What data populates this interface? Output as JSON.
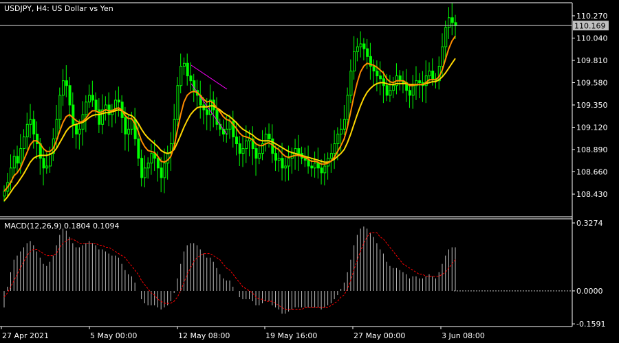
{
  "window": {
    "header": "USDJPY, H4:  US Dollar vs Yen",
    "current_price": "110.169",
    "macd_label": "MACD(12,26,9) 0.1804 0.1094"
  },
  "colors": {
    "background": "#000000",
    "bull_candle": "#00ff00",
    "bear_candle": "#00ff00",
    "ma_fast": "#ff8c00",
    "ma_slow": "#ffd700",
    "macd_hist": "#c0c0c0",
    "macd_signal": "#ff0000",
    "grid_line": "#c0c0c0",
    "price_tag_bg": "#c0c0c0",
    "trend_channel": "#ff00ff"
  },
  "price_axis": {
    "ticks": [
      "110.270",
      "110.040",
      "109.810",
      "109.580",
      "109.350",
      "109.120",
      "108.890",
      "108.660",
      "108.430"
    ]
  },
  "macd_axis": {
    "ticks": [
      "0.3274",
      "0.0000",
      "-0.1591"
    ]
  },
  "time_axis": {
    "ticks": [
      "27 Apr 2021",
      "5 May 00:00",
      "12 May 08:00",
      "19 May 16:00",
      "27 May 00:00",
      "3 Jun 08:00"
    ]
  },
  "chart_data": {
    "type": "line",
    "symbol": "USDJPY",
    "timeframe": "H4",
    "price_ylim": [
      108.33,
      110.33
    ],
    "macd_ylim": [
      -0.1591,
      0.3274
    ],
    "x_ticks": [
      "27 Apr 2021",
      "5 May 00:00",
      "12 May 08:00",
      "19 May 16:00",
      "27 May 00:00",
      "3 Jun 08:00"
    ],
    "price_close": [
      108.46,
      108.55,
      108.7,
      108.82,
      108.75,
      108.9,
      109.02,
      109.15,
      109.2,
      109.05,
      108.95,
      108.8,
      108.7,
      108.72,
      108.85,
      109.0,
      109.2,
      109.45,
      109.6,
      109.55,
      109.35,
      109.15,
      109.05,
      109.1,
      109.25,
      109.38,
      109.45,
      109.4,
      109.3,
      109.15,
      109.3,
      109.35,
      109.25,
      109.3,
      109.4,
      109.38,
      109.22,
      109.05,
      109.1,
      109.2,
      109.0,
      108.8,
      108.6,
      108.7,
      108.75,
      108.85,
      108.8,
      108.7,
      108.6,
      108.75,
      108.85,
      108.95,
      109.2,
      109.55,
      109.75,
      109.78,
      109.65,
      109.6,
      109.5,
      109.45,
      109.35,
      109.3,
      109.25,
      109.4,
      109.3,
      109.15,
      109.1,
      109.05,
      109.1,
      109.18,
      109.02,
      108.95,
      108.85,
      108.9,
      108.98,
      109.0,
      108.9,
      108.8,
      108.85,
      108.95,
      109.05,
      109.0,
      108.85,
      108.78,
      108.8,
      108.7,
      108.72,
      108.8,
      108.85,
      108.9,
      108.85,
      108.8,
      108.78,
      108.72,
      108.7,
      108.75,
      108.7,
      108.65,
      108.72,
      108.8,
      108.85,
      108.95,
      109.05,
      109.1,
      109.2,
      109.45,
      109.7,
      109.9,
      109.95,
      109.98,
      109.93,
      109.85,
      109.75,
      109.7,
      109.65,
      109.62,
      109.55,
      109.45,
      109.5,
      109.55,
      109.65,
      109.6,
      109.58,
      109.5,
      109.45,
      109.55,
      109.6,
      109.58,
      109.55,
      109.65,
      109.7,
      109.62,
      109.6,
      109.75,
      109.95,
      110.15,
      110.25,
      110.2,
      110.17
    ],
    "ma_fast": [
      108.46,
      108.5,
      108.55,
      108.62,
      108.65,
      108.7,
      108.78,
      108.86,
      108.94,
      108.98,
      108.98,
      108.95,
      108.9,
      108.87,
      108.87,
      108.9,
      108.98,
      109.08,
      109.17,
      109.23,
      109.25,
      109.22,
      109.19,
      109.17,
      109.18,
      109.21,
      109.26,
      109.29,
      109.29,
      109.27,
      109.28,
      109.3,
      109.29,
      109.29,
      109.31,
      109.32,
      109.3,
      109.24,
      109.21,
      109.21,
      109.16,
      109.08,
      108.98,
      108.92,
      108.88,
      108.87,
      108.86,
      108.82,
      108.77,
      108.76,
      108.78,
      108.82,
      108.92,
      109.09,
      109.25,
      109.38,
      109.45,
      109.48,
      109.49,
      109.48,
      109.45,
      109.41,
      109.38,
      109.39,
      109.37,
      109.32,
      109.28,
      109.23,
      109.2,
      109.19,
      109.15,
      109.11,
      109.06,
      109.03,
      109.02,
      109.01,
      108.99,
      108.95,
      108.93,
      108.93,
      108.95,
      108.96,
      108.94,
      108.91,
      108.89,
      108.85,
      108.82,
      108.81,
      108.82,
      108.83,
      108.83,
      108.82,
      108.81,
      108.79,
      108.77,
      108.77,
      108.76,
      108.74,
      108.74,
      108.75,
      108.77,
      108.81,
      108.87,
      108.93,
      109.0,
      109.12,
      109.28,
      109.44,
      109.58,
      109.69,
      109.75,
      109.78,
      109.77,
      109.76,
      109.74,
      109.71,
      109.68,
      109.62,
      109.59,
      109.58,
      109.6,
      109.6,
      109.6,
      109.58,
      109.55,
      109.55,
      109.56,
      109.56,
      109.56,
      109.58,
      109.61,
      109.61,
      109.61,
      109.64,
      109.71,
      109.82,
      109.93,
      110.01,
      110.06
    ],
    "ma_slow": [
      108.36,
      108.4,
      108.45,
      108.5,
      108.54,
      108.59,
      108.64,
      108.7,
      108.76,
      108.8,
      108.82,
      108.83,
      108.83,
      108.83,
      108.84,
      108.86,
      108.9,
      108.96,
      109.02,
      109.08,
      109.12,
      109.14,
      109.15,
      109.16,
      109.17,
      109.19,
      109.22,
      109.24,
      109.25,
      109.25,
      109.26,
      109.27,
      109.27,
      109.28,
      109.29,
      109.3,
      109.29,
      109.27,
      109.25,
      109.24,
      109.21,
      109.16,
      109.1,
      109.05,
      109.01,
      108.98,
      108.95,
      108.92,
      108.88,
      108.86,
      108.85,
      108.86,
      108.89,
      108.96,
      109.04,
      109.12,
      109.19,
      109.25,
      109.29,
      109.32,
      109.33,
      109.33,
      109.33,
      109.34,
      109.34,
      109.32,
      109.3,
      109.27,
      109.25,
      109.23,
      109.2,
      109.17,
      109.13,
      109.1,
      109.08,
      109.06,
      109.04,
      109.01,
      108.99,
      108.98,
      108.98,
      108.98,
      108.97,
      108.95,
      108.93,
      108.91,
      108.89,
      108.87,
      108.86,
      108.85,
      108.84,
      108.83,
      108.82,
      108.81,
      108.8,
      108.79,
      108.78,
      108.77,
      108.76,
      108.76,
      108.77,
      108.79,
      108.82,
      108.85,
      108.89,
      108.96,
      109.05,
      109.15,
      109.25,
      109.34,
      109.42,
      109.48,
      109.52,
      109.55,
      109.57,
      109.58,
      109.58,
      109.57,
      109.56,
      109.56,
      109.57,
      109.57,
      109.57,
      109.57,
      109.56,
      109.56,
      109.56,
      109.56,
      109.56,
      109.57,
      109.58,
      109.59,
      109.59,
      109.61,
      109.64,
      109.68,
      109.73,
      109.78,
      109.83
    ],
    "macd_hist": [
      -0.08,
      0.02,
      0.09,
      0.15,
      0.17,
      0.19,
      0.21,
      0.23,
      0.24,
      0.22,
      0.19,
      0.16,
      0.13,
      0.12,
      0.14,
      0.17,
      0.22,
      0.27,
      0.3,
      0.29,
      0.26,
      0.23,
      0.21,
      0.21,
      0.22,
      0.23,
      0.24,
      0.23,
      0.22,
      0.2,
      0.2,
      0.19,
      0.18,
      0.17,
      0.17,
      0.16,
      0.13,
      0.1,
      0.08,
      0.07,
      0.04,
      0.0,
      -0.04,
      -0.06,
      -0.07,
      -0.07,
      -0.07,
      -0.08,
      -0.09,
      -0.08,
      -0.07,
      -0.05,
      -0.01,
      0.06,
      0.13,
      0.19,
      0.22,
      0.23,
      0.23,
      0.22,
      0.2,
      0.18,
      0.16,
      0.16,
      0.14,
      0.11,
      0.08,
      0.06,
      0.05,
      0.05,
      0.02,
      0.0,
      -0.03,
      -0.04,
      -0.04,
      -0.04,
      -0.05,
      -0.07,
      -0.07,
      -0.06,
      -0.05,
      -0.05,
      -0.07,
      -0.08,
      -0.09,
      -0.11,
      -0.11,
      -0.1,
      -0.09,
      -0.08,
      -0.08,
      -0.08,
      -0.08,
      -0.08,
      -0.08,
      -0.08,
      -0.08,
      -0.09,
      -0.08,
      -0.07,
      -0.06,
      -0.04,
      -0.02,
      0.01,
      0.04,
      0.09,
      0.15,
      0.22,
      0.27,
      0.3,
      0.31,
      0.3,
      0.28,
      0.26,
      0.23,
      0.2,
      0.18,
      0.14,
      0.12,
      0.11,
      0.11,
      0.1,
      0.09,
      0.08,
      0.06,
      0.07,
      0.07,
      0.06,
      0.06,
      0.07,
      0.08,
      0.07,
      0.06,
      0.09,
      0.13,
      0.17,
      0.2,
      0.21,
      0.21
    ],
    "macd_signal": [
      -0.03,
      -0.01,
      0.02,
      0.05,
      0.08,
      0.11,
      0.14,
      0.17,
      0.19,
      0.2,
      0.2,
      0.19,
      0.18,
      0.17,
      0.17,
      0.17,
      0.18,
      0.21,
      0.23,
      0.24,
      0.25,
      0.25,
      0.24,
      0.23,
      0.23,
      0.23,
      0.23,
      0.23,
      0.23,
      0.22,
      0.22,
      0.21,
      0.21,
      0.2,
      0.19,
      0.18,
      0.17,
      0.16,
      0.14,
      0.12,
      0.1,
      0.08,
      0.05,
      0.03,
      0.01,
      -0.01,
      -0.02,
      -0.04,
      -0.05,
      -0.06,
      -0.06,
      -0.06,
      -0.05,
      -0.03,
      -0.0,
      0.04,
      0.08,
      0.11,
      0.14,
      0.16,
      0.17,
      0.18,
      0.18,
      0.18,
      0.17,
      0.16,
      0.15,
      0.13,
      0.11,
      0.1,
      0.08,
      0.06,
      0.04,
      0.02,
      0.01,
      -0.0,
      -0.01,
      -0.03,
      -0.04,
      -0.04,
      -0.05,
      -0.05,
      -0.05,
      -0.06,
      -0.07,
      -0.08,
      -0.09,
      -0.09,
      -0.09,
      -0.09,
      -0.09,
      -0.09,
      -0.08,
      -0.08,
      -0.08,
      -0.08,
      -0.08,
      -0.08,
      -0.08,
      -0.08,
      -0.07,
      -0.06,
      -0.05,
      -0.03,
      -0.02,
      0.01,
      0.05,
      0.1,
      0.15,
      0.19,
      0.23,
      0.26,
      0.28,
      0.28,
      0.28,
      0.26,
      0.25,
      0.23,
      0.21,
      0.19,
      0.17,
      0.15,
      0.13,
      0.12,
      0.11,
      0.1,
      0.09,
      0.08,
      0.08,
      0.07,
      0.07,
      0.07,
      0.07,
      0.07,
      0.08,
      0.09,
      0.11,
      0.13,
      0.15
    ]
  }
}
